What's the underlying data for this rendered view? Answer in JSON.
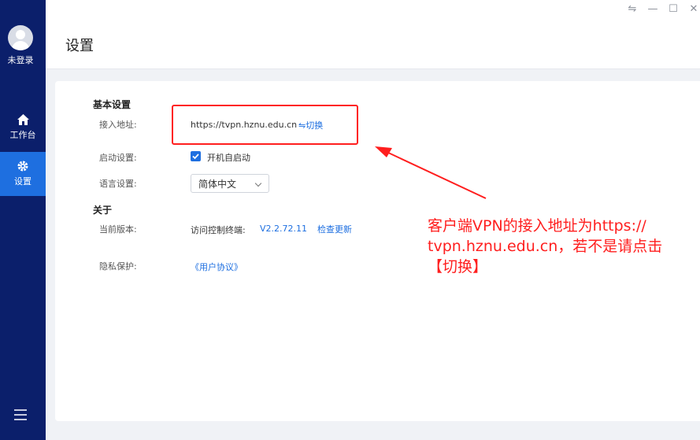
{
  "sidebar": {
    "user_label": "未登录",
    "items": [
      {
        "label": "工作台",
        "icon": "home-icon"
      },
      {
        "label": "设置",
        "icon": "gear-icon",
        "active": true
      }
    ],
    "menu_icon": "hamburger-menu-icon"
  },
  "header": {
    "title": "设置"
  },
  "window_controls": {
    "swap": "⇋",
    "minimize": "—",
    "maximize": "☐",
    "close": "✕"
  },
  "settings": {
    "basic_title": "基本设置",
    "access_label": "接入地址:",
    "access_value": "https://tvpn.hznu.edu.cn",
    "switch_label": "⇋切换",
    "startup_label": "启动设置:",
    "startup_checkbox_label": "开机自启动",
    "startup_checked": true,
    "language_label": "语言设置:",
    "language_value": "简体中文",
    "about_title": "关于",
    "version_label": "当前版本:",
    "version_prefix": "访问控制终端:",
    "version_value": "V2.2.72.11",
    "check_update": "检查更新",
    "privacy_label": "隐私保护:",
    "privacy_link": "《用户协议》"
  },
  "annotation": {
    "line1": "客户端VPN的接入地址为https://",
    "line2": "tvpn.hznu.edu.cn，若不是请点击",
    "line3": "【切换】",
    "color": "#ff1e1e"
  },
  "colors": {
    "sidebar_bg": "#0b1f6b",
    "active_item": "#1e6fe0",
    "link": "#1e6fe0"
  }
}
